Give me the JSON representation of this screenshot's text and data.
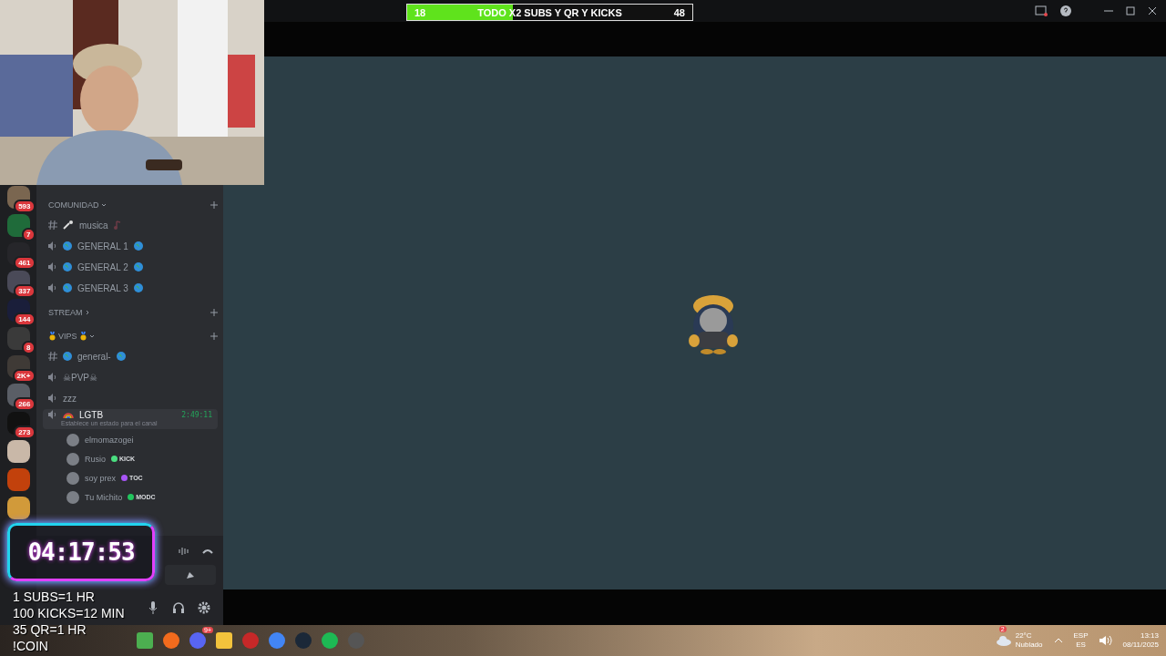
{
  "goal_bar": {
    "start": "18",
    "title": "TODO X2 SUBS Y QR Y KICKS",
    "end": "48",
    "level": 0.37
  },
  "servers": [
    {
      "badge": "593",
      "color": "#7a6650"
    },
    {
      "badge": "7",
      "color": "#1f6b3a"
    },
    {
      "badge": "461",
      "color": "#26262a"
    },
    {
      "badge": "337",
      "color": "#4a4a58"
    },
    {
      "badge": "144",
      "color": "#1a1e3a"
    },
    {
      "badge": "8",
      "color": "#3a3a3a"
    },
    {
      "badge": "2K+",
      "color": "#3f3a36"
    },
    {
      "badge": "266",
      "color": "#5a5e66"
    },
    {
      "badge": "273",
      "color": "#111111"
    },
    {
      "color": "#c9b8a8"
    },
    {
      "color": "#c2410c"
    },
    {
      "color": "#d19a3a"
    }
  ],
  "channels": [
    {
      "kind": "category",
      "label": "COMUNIDAD",
      "expanded": true
    },
    {
      "kind": "text",
      "label": "musica",
      "mic": true,
      "selected": false
    },
    {
      "kind": "voice",
      "label": "GENERAL 1",
      "globes": true,
      "selected": false
    },
    {
      "kind": "voice",
      "label": "GENERAL 2",
      "globes": true,
      "selected": false
    },
    {
      "kind": "voice",
      "label": "GENERAL 3",
      "globes": true,
      "selected": false
    },
    {
      "kind": "category",
      "label": "STREAM",
      "expanded": false
    },
    {
      "kind": "category",
      "label": "VIPS",
      "expanded": true,
      "medals": true
    },
    {
      "kind": "text",
      "label": "general-",
      "globes": true,
      "selected": false
    },
    {
      "kind": "voice",
      "label": "☠PVP☠",
      "selected": false
    },
    {
      "kind": "voice",
      "label": "zzz",
      "selected": false
    },
    {
      "kind": "voice",
      "label": "LGTB",
      "rainbow": true,
      "selected": true,
      "time": "2:49:11",
      "status": "Establece un estado para el canal",
      "members": [
        {
          "name": "elmomazogei"
        },
        {
          "name": "Rusio",
          "tag": "KICK",
          "color": "#4ade80"
        },
        {
          "name": "soy prex",
          "tag": "TOC",
          "color": "#a855f7"
        },
        {
          "name": "Tu Michito",
          "tag": "MODC",
          "color": "#22c55e"
        }
      ]
    }
  ],
  "timer": {
    "time": "04:17:53"
  },
  "goals_overlay": [
    "1 SUBS=1 HR",
    "100 KICKS=12 MIN",
    "35 QR=1 HR",
    "!COIN"
  ],
  "taskbar": {
    "apps": [
      {
        "kind": "square",
        "color": "#4caf50"
      },
      {
        "kind": "circle",
        "color": "#f26b1d"
      },
      {
        "kind": "circle",
        "color": "#5865f2",
        "badge": "9+"
      },
      {
        "kind": "square",
        "color": "#f3c33c"
      },
      {
        "kind": "circle",
        "color": "#c62828"
      },
      {
        "kind": "circle",
        "color": "#4285f4"
      },
      {
        "kind": "circle",
        "color": "#1b2838"
      },
      {
        "kind": "circle",
        "color": "#1db954"
      },
      {
        "kind": "circle",
        "color": "#555555"
      }
    ],
    "weather": {
      "badge": "2",
      "temp": "22°C",
      "desc": "Nublado"
    },
    "lang": {
      "top": "ESP",
      "bottom": "ES"
    },
    "clock": {
      "time": "13:13",
      "date": "08/11/2025"
    }
  }
}
